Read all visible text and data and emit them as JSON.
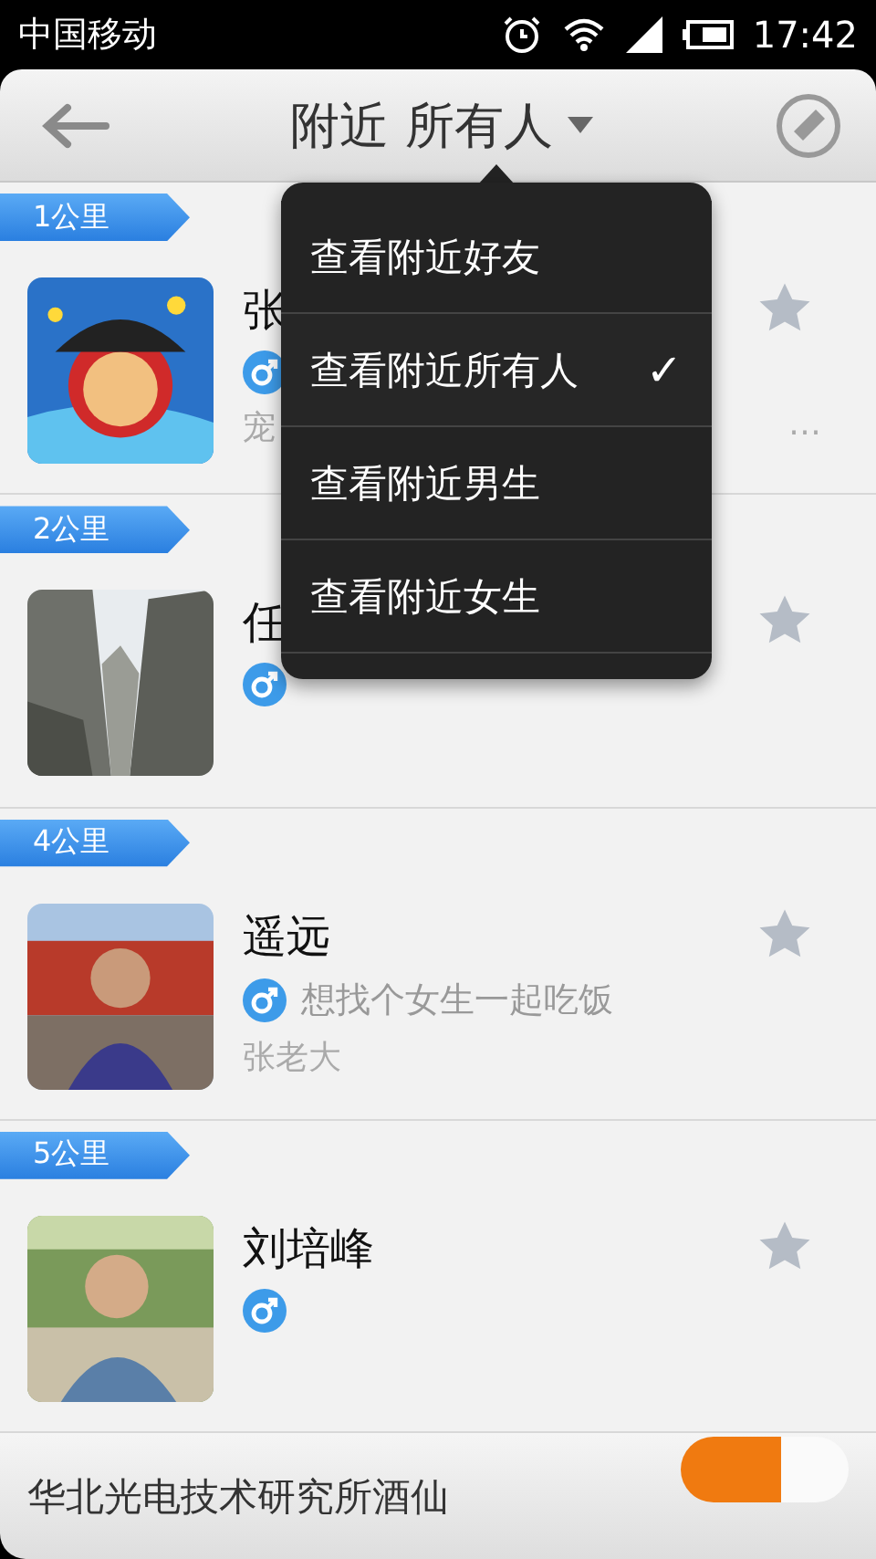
{
  "status_bar": {
    "carrier": "中国移动",
    "time": "17:42"
  },
  "header": {
    "title": "附近 所有人"
  },
  "menu": {
    "items": [
      {
        "label": "查看附近好友",
        "selected": false
      },
      {
        "label": "查看附近所有人",
        "selected": true
      },
      {
        "label": "查看附近男生",
        "selected": false
      },
      {
        "label": "查看附近女生",
        "selected": false
      }
    ],
    "check": "✓"
  },
  "sections": [
    {
      "distance": "1公里",
      "people": [
        {
          "name": "张",
          "kind": "male",
          "signature_start": "宠",
          "signature_end": "…"
        }
      ]
    },
    {
      "distance": "2公里",
      "people": [
        {
          "name": "任",
          "kind": "male"
        }
      ]
    },
    {
      "distance": "4公里",
      "people": [
        {
          "name": "遥远",
          "kind": "male",
          "status": "想找个女生一起吃饭",
          "signature": "张老大"
        }
      ]
    },
    {
      "distance": "5公里",
      "people": [
        {
          "name": "刘培峰",
          "kind": "male"
        }
      ]
    }
  ],
  "bottom_bar": {
    "text": "华北光电技术研究所酒仙",
    "switch_on": true
  }
}
